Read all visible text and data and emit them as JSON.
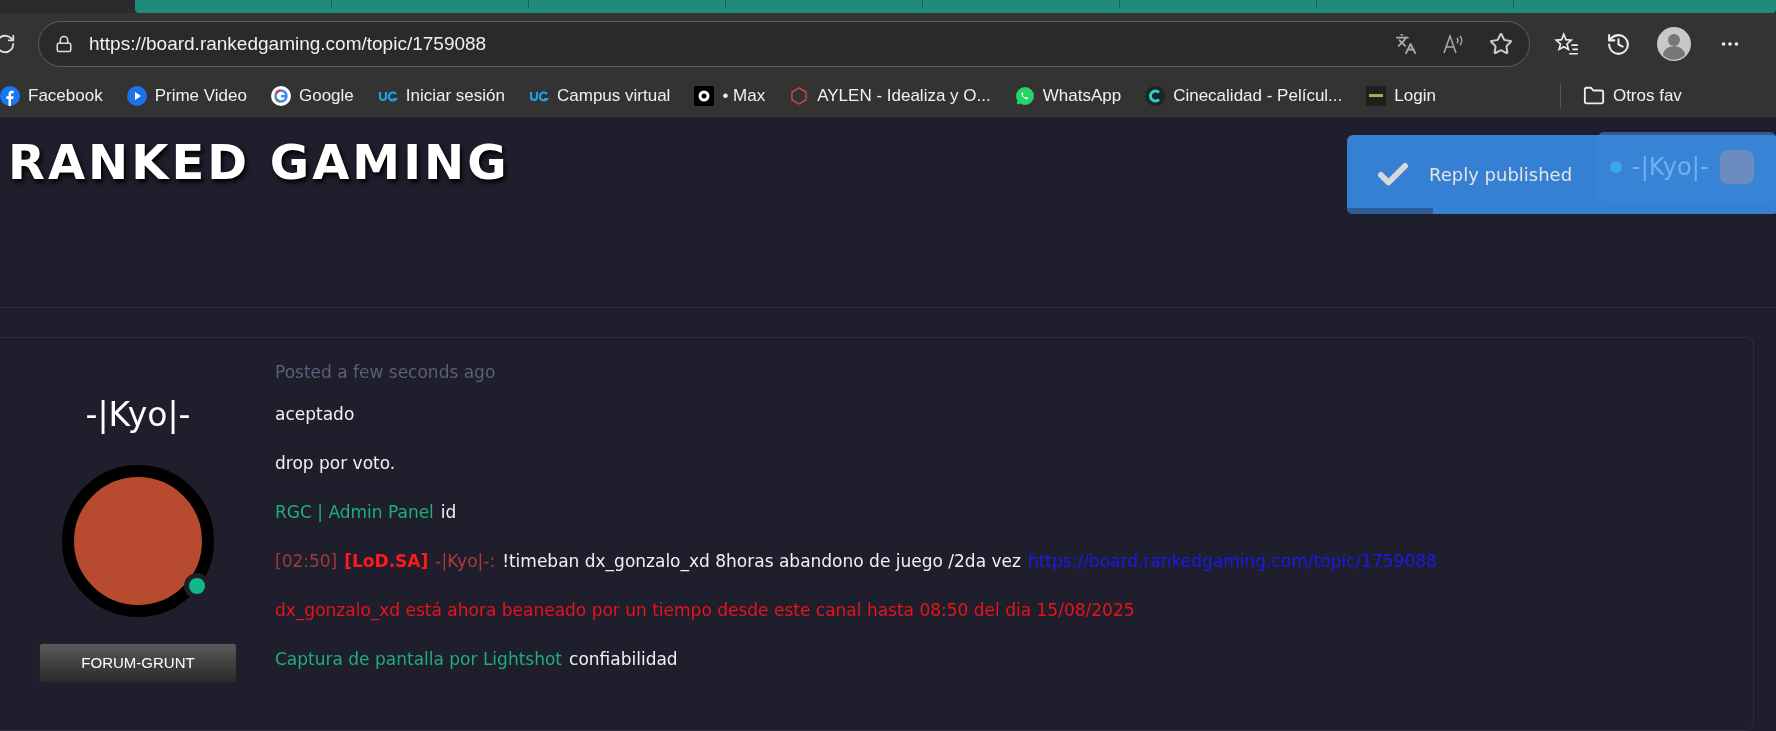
{
  "browser": {
    "address": "https://board.rankedgaming.com/topic/1759088",
    "bookmarks": [
      {
        "label": "Facebook",
        "kind": "facebook"
      },
      {
        "label": "Prime Video",
        "kind": "play"
      },
      {
        "label": "Google",
        "kind": "google"
      },
      {
        "label": "Iniciar sesión",
        "kind": "ug"
      },
      {
        "label": "Campus virtual",
        "kind": "ug"
      },
      {
        "label": "• Max",
        "kind": "max"
      },
      {
        "label": "AYLEN - Idealiza y O...",
        "kind": "hexagon"
      },
      {
        "label": "WhatsApp",
        "kind": "whatsapp"
      },
      {
        "label": "Cinecalidad - Películ...",
        "kind": "cinecalidad"
      },
      {
        "label": "Login",
        "kind": "login"
      }
    ],
    "other_favorites": "Otros fav"
  },
  "page": {
    "logo": "RANKED GAMING",
    "user_chip": {
      "name": "-|Kyo|-"
    },
    "toast": {
      "message": "Reply published",
      "level": 0.2
    },
    "post": {
      "posted": "Posted a few seconds ago",
      "author": "-|Kyo|-",
      "online": true,
      "rank": "FORUM-GRUNT",
      "paragraphs": [
        [
          {
            "kind": "text",
            "text": "aceptado"
          }
        ],
        [
          {
            "kind": "text",
            "text": "drop por voto."
          }
        ],
        [
          {
            "kind": "link",
            "text": "RGC | Admin Panel"
          },
          {
            "kind": "text",
            "text": "id"
          }
        ],
        [
          {
            "kind": "timestamp",
            "text": "[02:50]"
          },
          {
            "kind": "tag",
            "text": "[LoD.SA]"
          },
          {
            "kind": "nick",
            "text": "-|Kyo|-:"
          },
          {
            "kind": "text",
            "text": "!timeban dx_gonzalo_xd 8horas abandono de juego /2da vez"
          },
          {
            "kind": "url",
            "text": "https://board.rankedgaming.com/topic/1759088"
          }
        ],
        [
          {
            "kind": "alert",
            "text": "dx_gonzalo_xd está ahora beaneado por un tiempo desde este canal hasta 08:50 del dia 15/08/2025"
          }
        ],
        [
          {
            "kind": "link",
            "text": "Captura de pantalla por Lightshot"
          },
          {
            "kind": "text",
            "text": "confiabilidad"
          }
        ]
      ]
    }
  }
}
